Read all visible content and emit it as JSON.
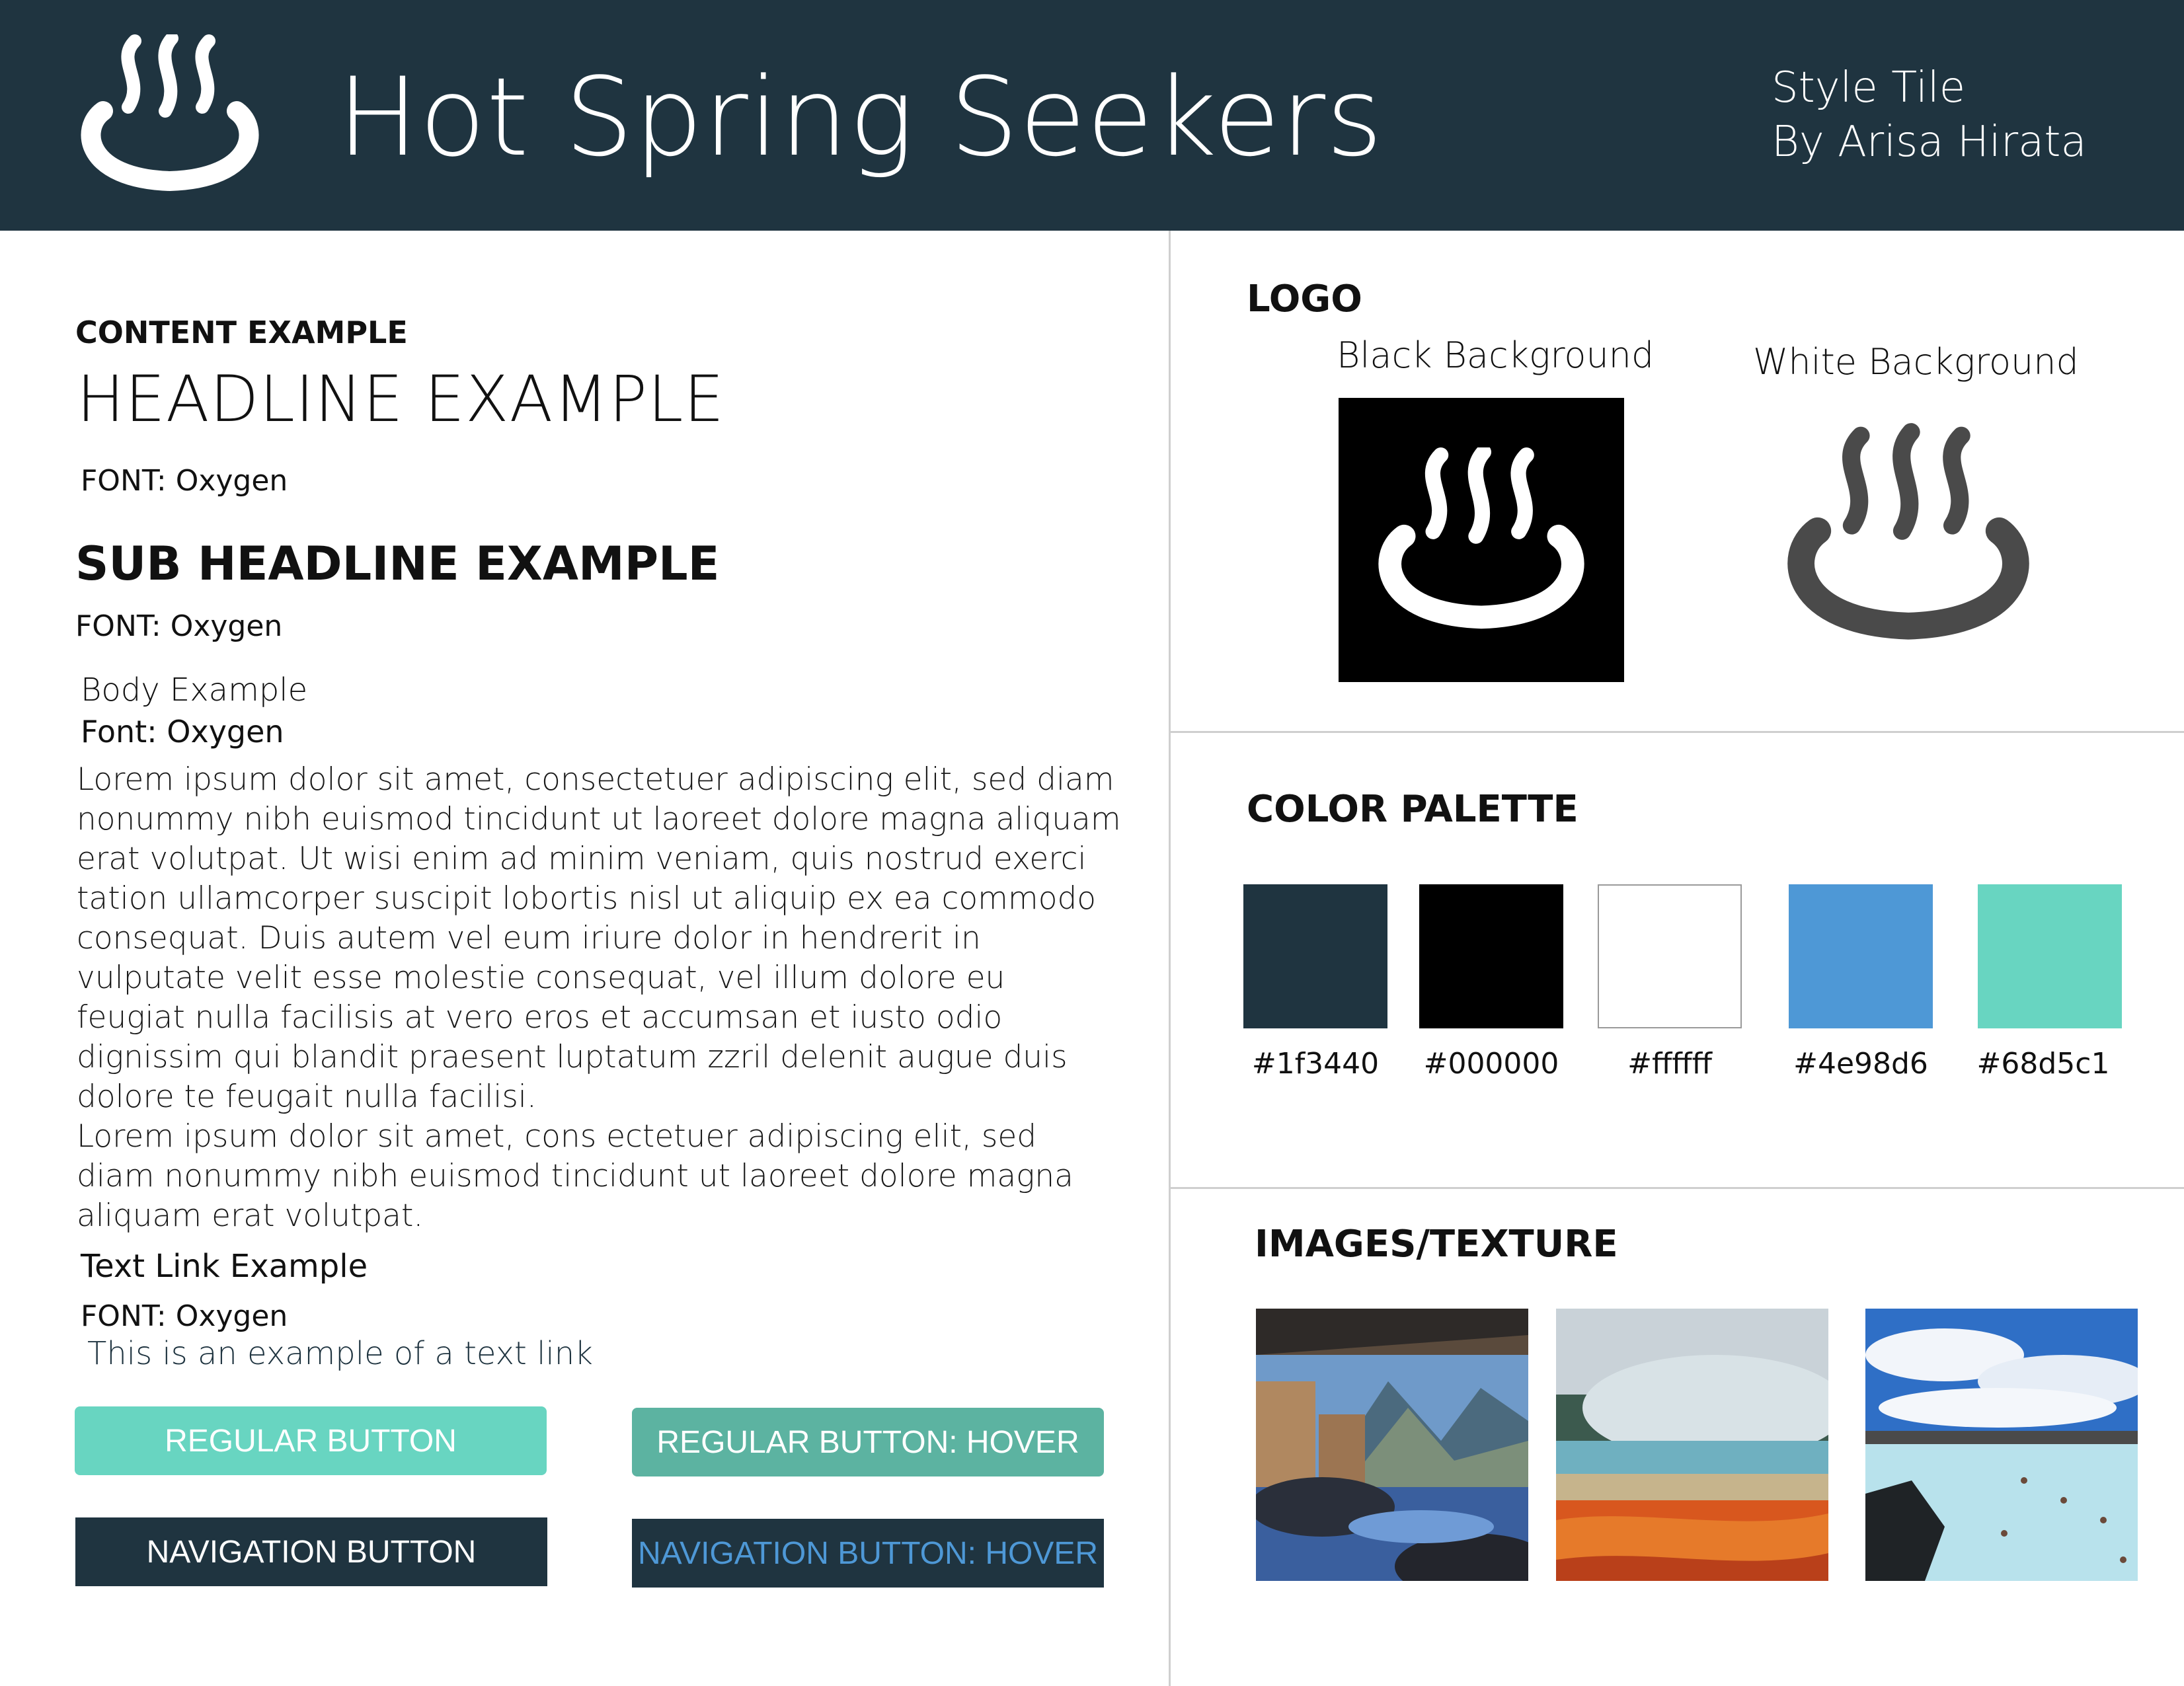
{
  "header": {
    "title": "Hot Spring Seekers",
    "meta_line1": "Style Tile",
    "meta_line2": "By Arisa Hirata",
    "background": "#1f3440",
    "logo_icon": "hot-spring-icon"
  },
  "content": {
    "section_label": "CONTENT EXAMPLE",
    "headline": "HEADLINE EXAMPLE",
    "headline_font": "FONT: Oxygen",
    "subheadline": "SUB HEADLINE EXAMPLE",
    "subheadline_font": "FONT: Oxygen",
    "body_label": "Body Example",
    "body_font": "Font: Oxygen",
    "body_paragraph_1": "Lorem ipsum dolor sit amet, consectetuer adipiscing elit, sed diam nonummy nibh euismod tincidunt ut laoreet dolore magna aliquam erat volutpat. Ut wisi enim ad minim veniam, quis nostrud exerci tation ullamcorper suscipit lobortis nisl ut aliquip ex ea commodo consequat. Duis autem vel eum iriure dolor in hendrerit in vulputate velit esse molestie consequat, vel illum dolore eu feugiat nulla facilisis at vero eros et accumsan et iusto odio dignissim qui blandit praesent luptatum zzril delenit augue duis dolore te feugait nulla facilisi.",
    "body_paragraph_2": "Lorem ipsum dolor sit amet, cons ectetuer adipiscing elit, sed diam nonummy nibh euismod tincidunt ut laoreet dolore magna aliquam erat volutpat.",
    "link_label": "Text Link Example",
    "link_font": "FONT: Oxygen",
    "link_text": "This is an example of a text link"
  },
  "buttons": {
    "regular": "REGULAR BUTTON",
    "regular_hover": "REGULAR BUTTON: HOVER",
    "navigation": "NAVIGATION BUTTON",
    "navigation_hover": "NAVIGATION BUTTON: HOVER"
  },
  "logo_section": {
    "title": "LOGO",
    "black_label": "Black Background",
    "white_label": "White Background"
  },
  "palette": {
    "title": "COLOR PALETTE",
    "colors": [
      {
        "hex": "#1f3440",
        "label": "#1f3440"
      },
      {
        "hex": "#000000",
        "label": "#000000"
      },
      {
        "hex": "#ffffff",
        "label": "#ffffff"
      },
      {
        "hex": "#4e98d6",
        "label": "#4e98d6"
      },
      {
        "hex": "#68d5c1",
        "label": "#68d5c1"
      }
    ]
  },
  "images": {
    "title": "IMAGES/TEXTURE",
    "items": [
      "outdoor-onsen-photo",
      "geothermal-pool-photo",
      "lagoon-bathers-photo"
    ]
  }
}
